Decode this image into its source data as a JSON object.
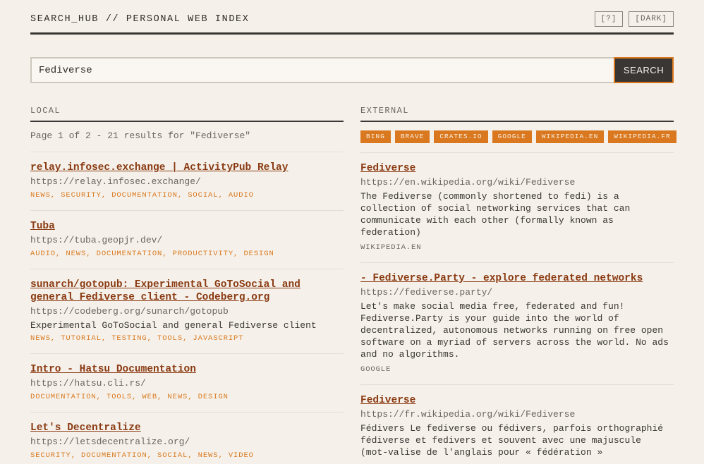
{
  "header": {
    "title": "SEARCH_HUB // PERSONAL WEB INDEX",
    "help_label": "[?]",
    "dark_label": "[DARK]"
  },
  "search": {
    "value": "Fediverse",
    "button_label": "SEARCH"
  },
  "local": {
    "heading": "LOCAL",
    "page_info": "Page 1 of 2 - 21 results for \"Fediverse\"",
    "results": [
      {
        "title": "relay.infosec.exchange | ActivityPub Relay",
        "url": "https://relay.infosec.exchange/",
        "desc": "",
        "tags": "NEWS, SECURITY, DOCUMENTATION, SOCIAL, AUDIO"
      },
      {
        "title": "Tuba",
        "url": "https://tuba.geopjr.dev/",
        "desc": "",
        "tags": "AUDIO, NEWS, DOCUMENTATION, PRODUCTIVITY, DESIGN"
      },
      {
        "title": "sunarch/gotopub: Experimental GoToSocial and general Fediverse client - Codeberg.org",
        "url": "https://codeberg.org/sunarch/gotopub",
        "desc": "Experimental GoToSocial and general Fediverse client",
        "tags": "NEWS, TUTORIAL, TESTING, TOOLS, JAVASCRIPT"
      },
      {
        "title": "Intro - Hatsu Documentation",
        "url": "https://hatsu.cli.rs/",
        "desc": "",
        "tags": "DOCUMENTATION, TOOLS, WEB, NEWS, DESIGN"
      },
      {
        "title": "Let's Decentralize",
        "url": "https://letsdecentralize.org/",
        "desc": "",
        "tags": "SECURITY, DOCUMENTATION, SOCIAL, NEWS, VIDEO"
      }
    ]
  },
  "external": {
    "heading": "EXTERNAL",
    "engines": [
      "BING",
      "BRAVE",
      "CRATES.IO",
      "GOOGLE",
      "WIKIPEDIA.EN",
      "WIKIPEDIA.FR"
    ],
    "results": [
      {
        "title": "Fediverse",
        "url": "https://en.wikipedia.org/wiki/Fediverse",
        "desc": "The Fediverse (commonly shortened to fedi) is a collection of social networking services that can communicate with each other (formally known as federation)",
        "source": "WIKIPEDIA.EN"
      },
      {
        "title": "- Fediverse.Party - explore federated networks",
        "url": "https://fediverse.party/",
        "desc": "Let's make social media free, federated and fun! Fediverse.Party is your guide into the world of decentralized, autonomous networks running on free open software on a myriad of servers across the world. No ads and no algorithms.",
        "source": "GOOGLE"
      },
      {
        "title": "Fediverse",
        "url": "https://fr.wikipedia.org/wiki/Fediverse",
        "desc": "Fédivers Le fediverse ou fédivers, parfois orthographié fédiverse et fedivers et souvent avec une majuscule (mot-valise de l'anglais pour « fédération »",
        "source": "WIKIPEDIA.FR"
      }
    ]
  }
}
